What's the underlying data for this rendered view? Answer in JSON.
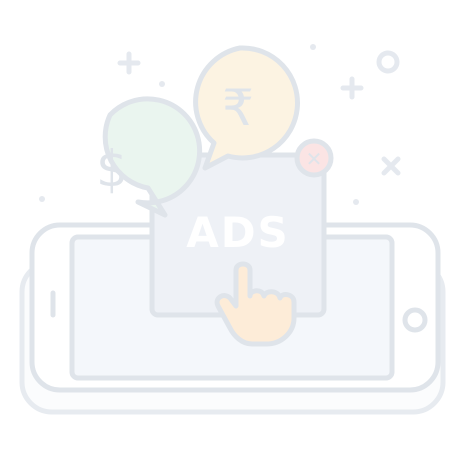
{
  "illustration": {
    "ads_label": "ADS",
    "dollar_symbol": "$",
    "rupee_symbol": "₹",
    "close_symbol": "✕"
  },
  "colors": {
    "outline": "#dfe4ea",
    "card_fill": "#eef1f6",
    "phone_screen": "#f4f7fb",
    "dollar_bubble": "#eaf5ef",
    "rupee_bubble": "#fcf3e2",
    "close_badge": "#fbe4e4",
    "hand_fill": "#fdecd8",
    "sparkle": "#e5e9ef"
  }
}
